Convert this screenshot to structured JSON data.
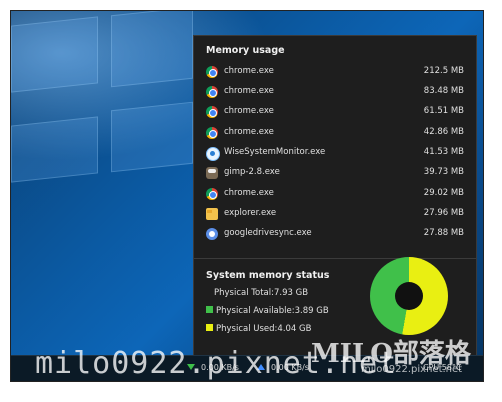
{
  "memory_usage": {
    "title": "Memory usage",
    "processes": [
      {
        "name": "chrome.exe",
        "memory": "212.5 MB",
        "icon": "chrome-icon"
      },
      {
        "name": "chrome.exe",
        "memory": "83.48 MB",
        "icon": "chrome-icon"
      },
      {
        "name": "chrome.exe",
        "memory": "61.51 MB",
        "icon": "chrome-icon"
      },
      {
        "name": "chrome.exe",
        "memory": "42.86 MB",
        "icon": "chrome-icon"
      },
      {
        "name": "WiseSystemMonitor.exe",
        "memory": "41.53 MB",
        "icon": "wise-system-monitor-icon"
      },
      {
        "name": "gimp-2.8.exe",
        "memory": "39.73 MB",
        "icon": "gimp-icon"
      },
      {
        "name": "chrome.exe",
        "memory": "29.02 MB",
        "icon": "chrome-icon"
      },
      {
        "name": "explorer.exe",
        "memory": "27.96 MB",
        "icon": "folder-icon"
      },
      {
        "name": "googledrivesync.exe",
        "memory": "27.88 MB",
        "icon": "google-drive-sync-icon"
      }
    ]
  },
  "system_memory_status": {
    "title": "System memory status",
    "physical_total": "Physical Total:7.93 GB",
    "physical_available": "Physical Available:3.89 GB",
    "physical_used": "Physical Used:4.04 GB",
    "colors": {
      "available": "#40c04a",
      "used": "#e9ef12"
    }
  },
  "taskbar": {
    "download": "0.00 KB/s",
    "upload": "0.00 KB/s",
    "cpu": "CPU 58°C",
    "icons": {
      "download": "download-arrow-icon",
      "upload": "upload-arrow-icon"
    }
  },
  "watermark": {
    "url": "milo0922.pixnet.net",
    "brand": "MILO部落格",
    "small": "milo0922.pixnet.net"
  }
}
